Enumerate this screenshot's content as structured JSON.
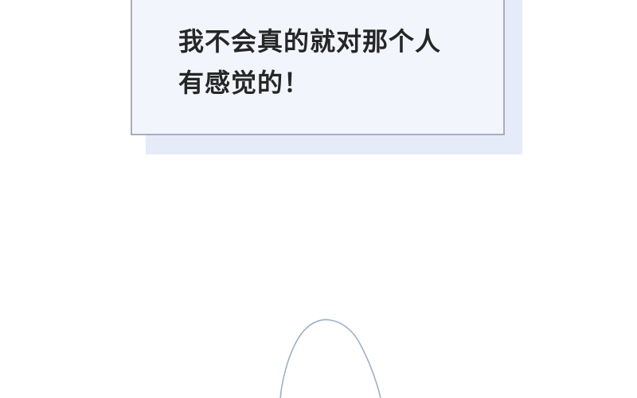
{
  "caption": {
    "lines": [
      "我不会真的就对那个人",
      "有感觉的！"
    ],
    "box_color": "#f3f5fd",
    "shadow_color": "#e6ebfa",
    "border_color": "#a9acc1",
    "text_color": "#262626"
  },
  "artwork": {
    "outline_color": "#9fb0c4"
  }
}
